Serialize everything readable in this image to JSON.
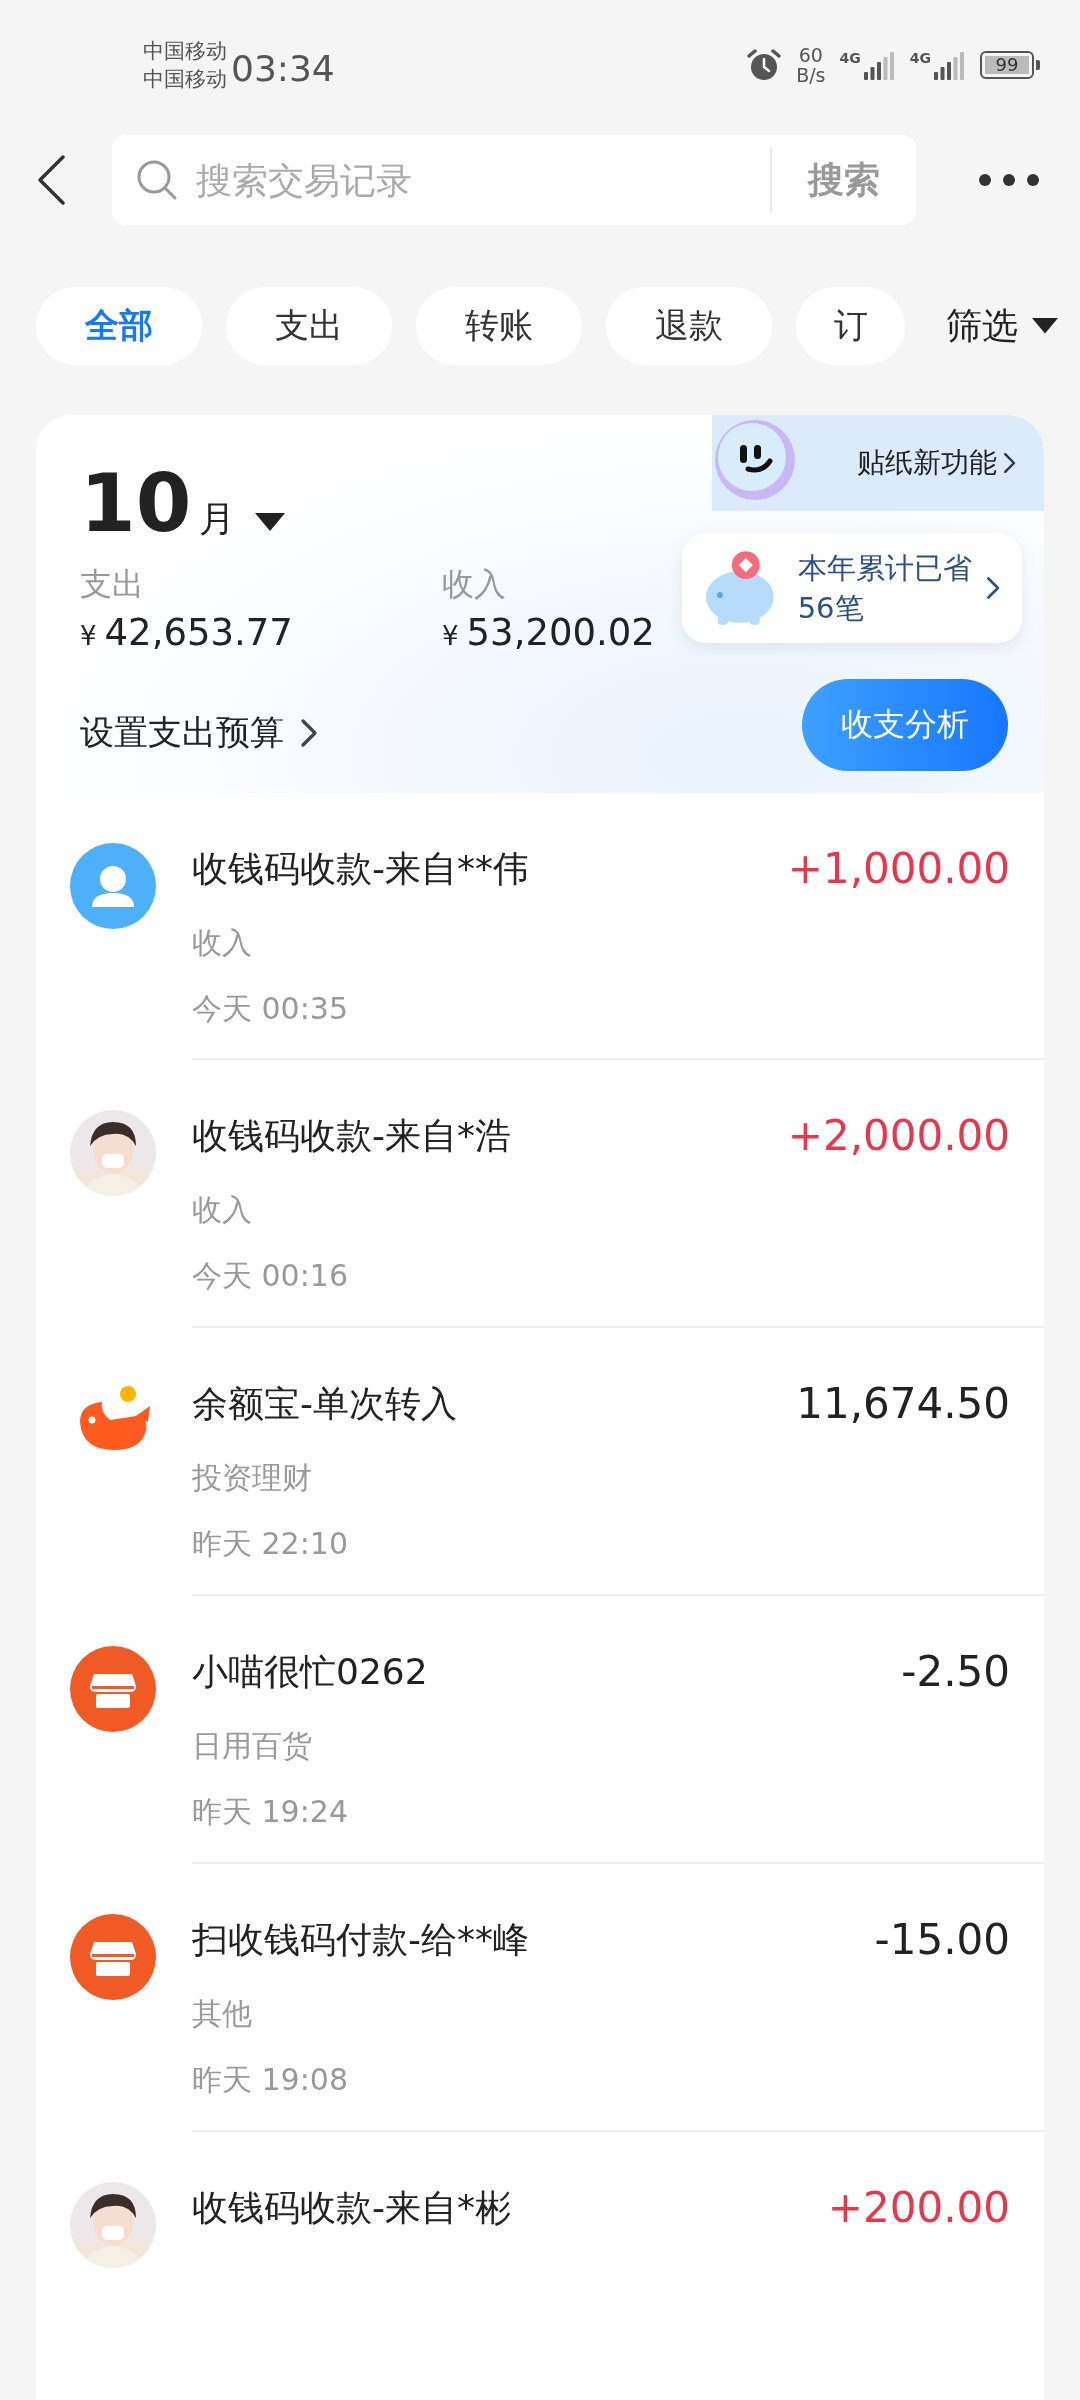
{
  "status_bar": {
    "carriers": [
      "中国移动",
      "中国移动"
    ],
    "time": "03:34",
    "speed_value": "60",
    "speed_unit": "B/s",
    "networks": [
      "4G",
      "4G"
    ],
    "battery": "99"
  },
  "search": {
    "placeholder": "搜索交易记录",
    "button": "搜索"
  },
  "tabs": [
    {
      "label": "全部",
      "selected": true
    },
    {
      "label": "支出",
      "selected": false
    },
    {
      "label": "转账",
      "selected": false
    },
    {
      "label": "退款",
      "selected": false
    },
    {
      "label": "订",
      "selected": false
    }
  ],
  "filter": {
    "label": "筛选"
  },
  "summary": {
    "month_number": "10",
    "month_unit": "月",
    "expense_label": "支出",
    "expense_amount": "42,653.77",
    "income_label": "收入",
    "income_amount": "53,200.02",
    "currency": "¥",
    "budget_link": "设置支出预算",
    "sticker_banner": "贴纸新功能",
    "savings_title": "本年累计已省",
    "savings_count": "56笔",
    "analysis_button": "收支分析"
  },
  "transactions": [
    {
      "kind": "user",
      "title": "收钱码收款-来自**伟",
      "amount": "+1,000.00",
      "income": true,
      "category": "收入",
      "time": "今天 00:35"
    },
    {
      "kind": "picture",
      "title": "收钱码收款-来自*浩",
      "amount": "+2,000.00",
      "income": true,
      "category": "收入",
      "time": "今天 00:16"
    },
    {
      "kind": "fish",
      "title": "余额宝-单次转入",
      "amount": "11,674.50",
      "income": false,
      "category": "投资理财",
      "time": "昨天 22:10"
    },
    {
      "kind": "shop",
      "title": "小喵很忙0262",
      "amount": "-2.50",
      "income": false,
      "category": "日用百货",
      "time": "昨天 19:24"
    },
    {
      "kind": "shop",
      "title": "扫收钱码付款-给**峰",
      "amount": "-15.00",
      "income": false,
      "category": "其他",
      "time": "昨天 19:08"
    },
    {
      "kind": "picture",
      "title": "收钱码收款-来自*彬",
      "amount": "+200.00",
      "income": true
    }
  ]
}
